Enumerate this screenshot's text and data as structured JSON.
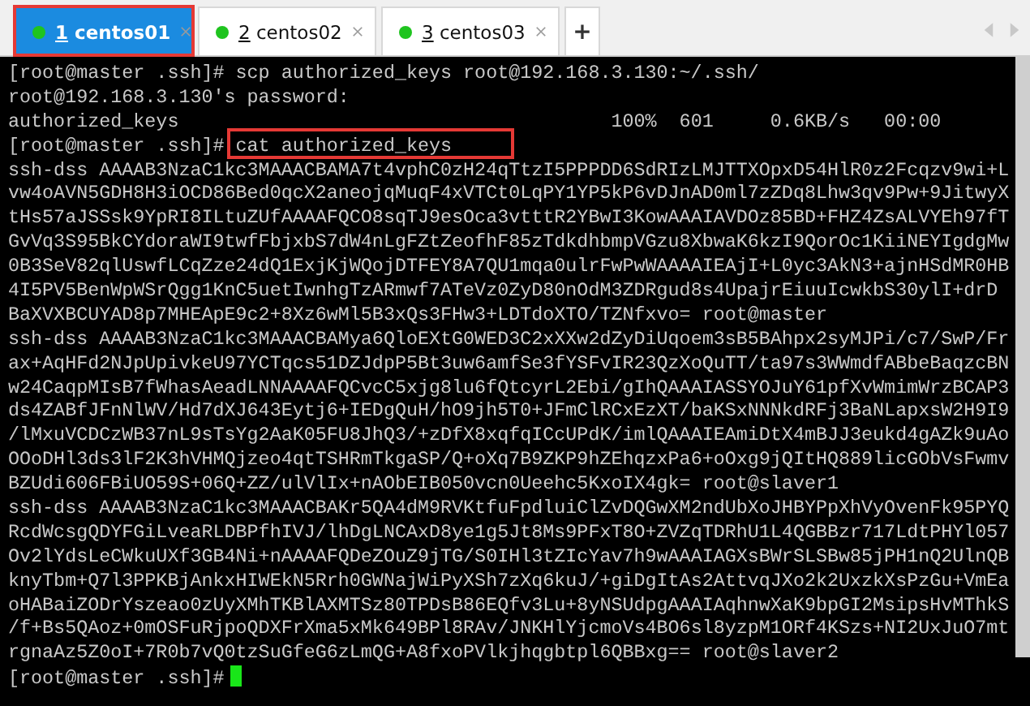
{
  "tabs": [
    {
      "number": "1",
      "label": "centos01",
      "selected": true,
      "highlighted": true
    },
    {
      "number": "2",
      "label": "centos02",
      "selected": false,
      "highlighted": false
    },
    {
      "number": "3",
      "label": "centos03",
      "selected": false,
      "highlighted": false
    }
  ],
  "new_tab": "+",
  "terminal": {
    "lines": [
      {
        "kind": "prompt",
        "prompt": "[root@master .ssh]#",
        "command": "scp authorized_keys root@192.168.3.130:~/.ssh/"
      },
      {
        "kind": "output",
        "text": "root@192.168.3.130's password:"
      },
      {
        "kind": "output",
        "text": "authorized_keys                                      100%  601     0.6KB/s   00:00"
      },
      {
        "kind": "prompt",
        "prompt": "[root@master .ssh]#",
        "command": "cat authorized_keys",
        "highlighted": true
      },
      {
        "kind": "output",
        "text": "ssh-dss AAAAB3NzaC1kc3MAAACBAMA7t4vphC0zH24qTtzI5PPPDD6SdRIzLMJTTXOpxD54HlR0z2Fcqzv9wi+L"
      },
      {
        "kind": "output",
        "text": "vw4oAVN5GDH8H3iOCD86Bed0qcX2aneojqMuqF4xVTCt0LqPY1YP5kP6vDJnAD0ml7zZDq8Lhw3qv9Pw+9JitwyX"
      },
      {
        "kind": "output",
        "text": "tHs57aJSSsk9YpRI8ILtuZUfAAAAFQCO8sqTJ9esOca3vtttR2YBwI3KowAAAIAVDOz85BD+FHZ4ZsALVYEh97fT"
      },
      {
        "kind": "output",
        "text": "GvVq3S95BkCYdoraWI9twfFbjxbS7dW4nLgFZtZeofhF85zTdkdhbmpVGzu8XbwaK6kzI9QorOc1KiiNEYIgdgMw"
      },
      {
        "kind": "output",
        "text": "0B3SeV82qlUswfLCqZze24dQ1ExjKjWQojDTFEY8A7QU1mqa0ulrFwPwWAAAAIEAjI+L0yc3AkN3+ajnHSdMR0HB"
      },
      {
        "kind": "output",
        "text": "4I5PV5BenWpWSrQgg1KnC5uetIwnhgTzARmwf7ATeVz0ZyD80nOdM3ZDRgud8s4UpajrEiuuIcwkbS30ylI+drD"
      },
      {
        "kind": "output",
        "text": "BaXVXBCUYAD8p7MHEApE9c2+8Xz6wMl5B3xQs3FHw3+LDTdoXTO/TZNfxvo= root@master"
      },
      {
        "kind": "output",
        "text": "ssh-dss AAAAB3NzaC1kc3MAAACBAMya6QloEXtG0WED3C2xXXw2dZyDiUqoem3sB5BAhpx2syMJPi/c7/SwP/Fr"
      },
      {
        "kind": "output",
        "text": "ax+AqHFd2NJpUpivkeU97YCTqcs51DZJdpP5Bt3uw6amfSe3fYSFvIR23QzXoQuTT/ta97s3WWmdfABbeBaqzcBN"
      },
      {
        "kind": "output",
        "text": "w24CaqpMIsB7fWhasAeadLNNAAAAFQCvcC5xjg8lu6fQtcyrL2Ebi/gIhQAAAIASSYOJuY61pfXvWmimWrzBCAP3"
      },
      {
        "kind": "output",
        "text": "ds4ZABfJFnNlWV/Hd7dXJ643Eytj6+IEDgQuH/hO9jh5T0+JFmClRCxEzXT/baKSxNNNkdRFj3BaNLapxsW2H9I9"
      },
      {
        "kind": "output",
        "text": "/lMxuVCDCzWB37nL9sTsYg2AaK05FU8JhQ3/+zDfX8xqfqICcUPdK/imlQAAAIEAmiDtX4mBJJ3eukd4gAZk9uAo"
      },
      {
        "kind": "output",
        "text": "OOoDHl3ds3lF2K3hVHMQjzeo4qtTSHRmTkgaSP/Q+oXq7B9ZKP9hZEhqzxPa6+oOxg9jQItHQ889licGObVsFwmv"
      },
      {
        "kind": "output",
        "text": "BZUdi606FBiUO59S+06Q+ZZ/ulVlIx+nAObEIB050vcn0Ueehc5KxoIX4gk= root@slaver1"
      },
      {
        "kind": "output",
        "text": "ssh-dss AAAAB3NzaC1kc3MAAACBAKr5QA4dM9RVKtfuFpdluiClZvDQGwXM2ndUbXoJHBYPpXhVyOvenFk95PYQ"
      },
      {
        "kind": "output",
        "text": "RcdWcsgQDYFGiLveaRLDBPfhIVJ/lhDgLNCAxD8ye1g5Jt8Ms9PFxT8O+ZVZqTDRhU1L4QGBBzr717LdtPHYl057"
      },
      {
        "kind": "output",
        "text": "Ov2lYdsLeCWkuUXf3GB4Ni+nAAAAFQDeZOuZ9jTG/S0IHl3tZIcYav7h9wAAAIAGXsBWrSLSBw85jPH1nQ2UlnQB"
      },
      {
        "kind": "output",
        "text": "knyTbm+Q7l3PPKBjAnkxHIWEkN5Rrh0GWNajWiPyXSh7zXq6kuJ/+giDgItAs2AttvqJXo2k2UxzkXsPzGu+VmEa"
      },
      {
        "kind": "output",
        "text": "oHABaiZODrYszeao0zUyXMhTKBlAXMTSz80TPDsB86EQfv3Lu+8yNSUdpgAAAIAqhnwXaK9bpGI2MsipsHvMThkS"
      },
      {
        "kind": "output",
        "text": "/f+Bs5QAoz+0mOSFuRjpoQDXFrXma5xMk649BPl8RAv/JNKHlYjcmoVs4BO6sl8yzpM1ORf4KSzs+NI2UxJuO7mt"
      },
      {
        "kind": "output",
        "text": "rgnaAz5Z0oI+7R0b7vQ0tzSuGfeG6zLmQG+A8fxoPVlkjhqgbtpl6QBBxg== root@slaver2"
      },
      {
        "kind": "prompt",
        "prompt": "[root@master .ssh]#",
        "cursor": true
      }
    ]
  }
}
